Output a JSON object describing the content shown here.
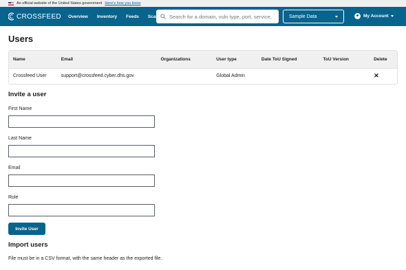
{
  "gov_banner": {
    "text": "An official website of the United States government",
    "link": "Here's how you know"
  },
  "header": {
    "logo_text": "CROSSFEED",
    "nav": [
      "Overview",
      "Inventory",
      "Feeds",
      "Scans"
    ],
    "search_placeholder": "Search for a domain, vuln type, port, service, IP",
    "org_select": "Sample Data",
    "account_label": "My Account"
  },
  "page_title": "Users",
  "users_table": {
    "columns": [
      "Name",
      "Email",
      "Organizations",
      "User type",
      "Date ToU Signed",
      "ToU Version",
      "Delete"
    ],
    "rows": [
      {
        "name": "Crossfeed User",
        "email": "support@crossfeed.cyber.dhs.gov",
        "organizations": "",
        "user_type": "Global Admin",
        "tou_signed": "",
        "tou_version": "",
        "delete_glyph": "✕"
      }
    ]
  },
  "invite": {
    "title": "Invite a user",
    "first_name_label": "First Name",
    "last_name_label": "Last Name",
    "email_label": "Email",
    "role_label": "Role",
    "submit_label": "Invite User"
  },
  "import": {
    "title": "Import users",
    "help": "File must be in a CSV format, with the same header as the exported file."
  },
  "colors": {
    "brand": "#07648d",
    "banner_bg": "#f0f0f0"
  },
  "icons": [
    "flag-icon",
    "logo-icon",
    "search-icon",
    "chevron-down-icon",
    "user-circle-icon",
    "close-icon"
  ]
}
